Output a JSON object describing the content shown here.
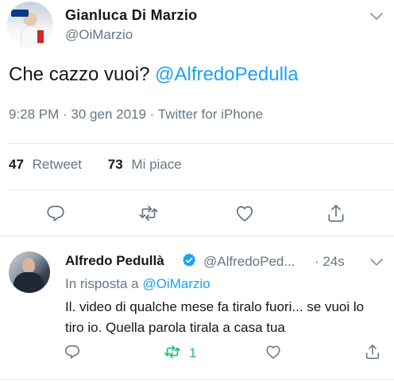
{
  "main_tweet": {
    "author_name": "Gianluca Di Marzio",
    "author_handle": "@OiMarzio",
    "text_plain": "Che cazzo vuoi?",
    "text_mention": "@AlfredoPedulla",
    "timestamp": "9:28 PM · 30 gen 2019 · Twitter for iPhone",
    "retweets_count": "47",
    "retweets_label": "Retweet",
    "likes_count": "73",
    "likes_label": "Mi piace",
    "actions": [
      "reply-icon",
      "retweet-icon",
      "like-icon",
      "share-icon"
    ]
  },
  "reply_tweet": {
    "author_name": "Alfredo Pedullà",
    "author_handle": "@AlfredoPed...",
    "time": "· 24s",
    "in_reply_prefix": "In risposta a",
    "in_reply_handle": "@OiMarzio",
    "text": "Il. video di qualche mese fa tiralo fuori... se vuoi lo tiro io. Quella parola tirala a casa tua",
    "retweet_count": "1",
    "actions": [
      "reply-icon",
      "retweet-icon",
      "like-icon",
      "share-icon"
    ]
  },
  "colors": {
    "accent": "#1da1f2",
    "text": "#14171a",
    "secondary": "#657786",
    "divider": "#e1e8ed",
    "retweet_active": "#17bf63"
  }
}
